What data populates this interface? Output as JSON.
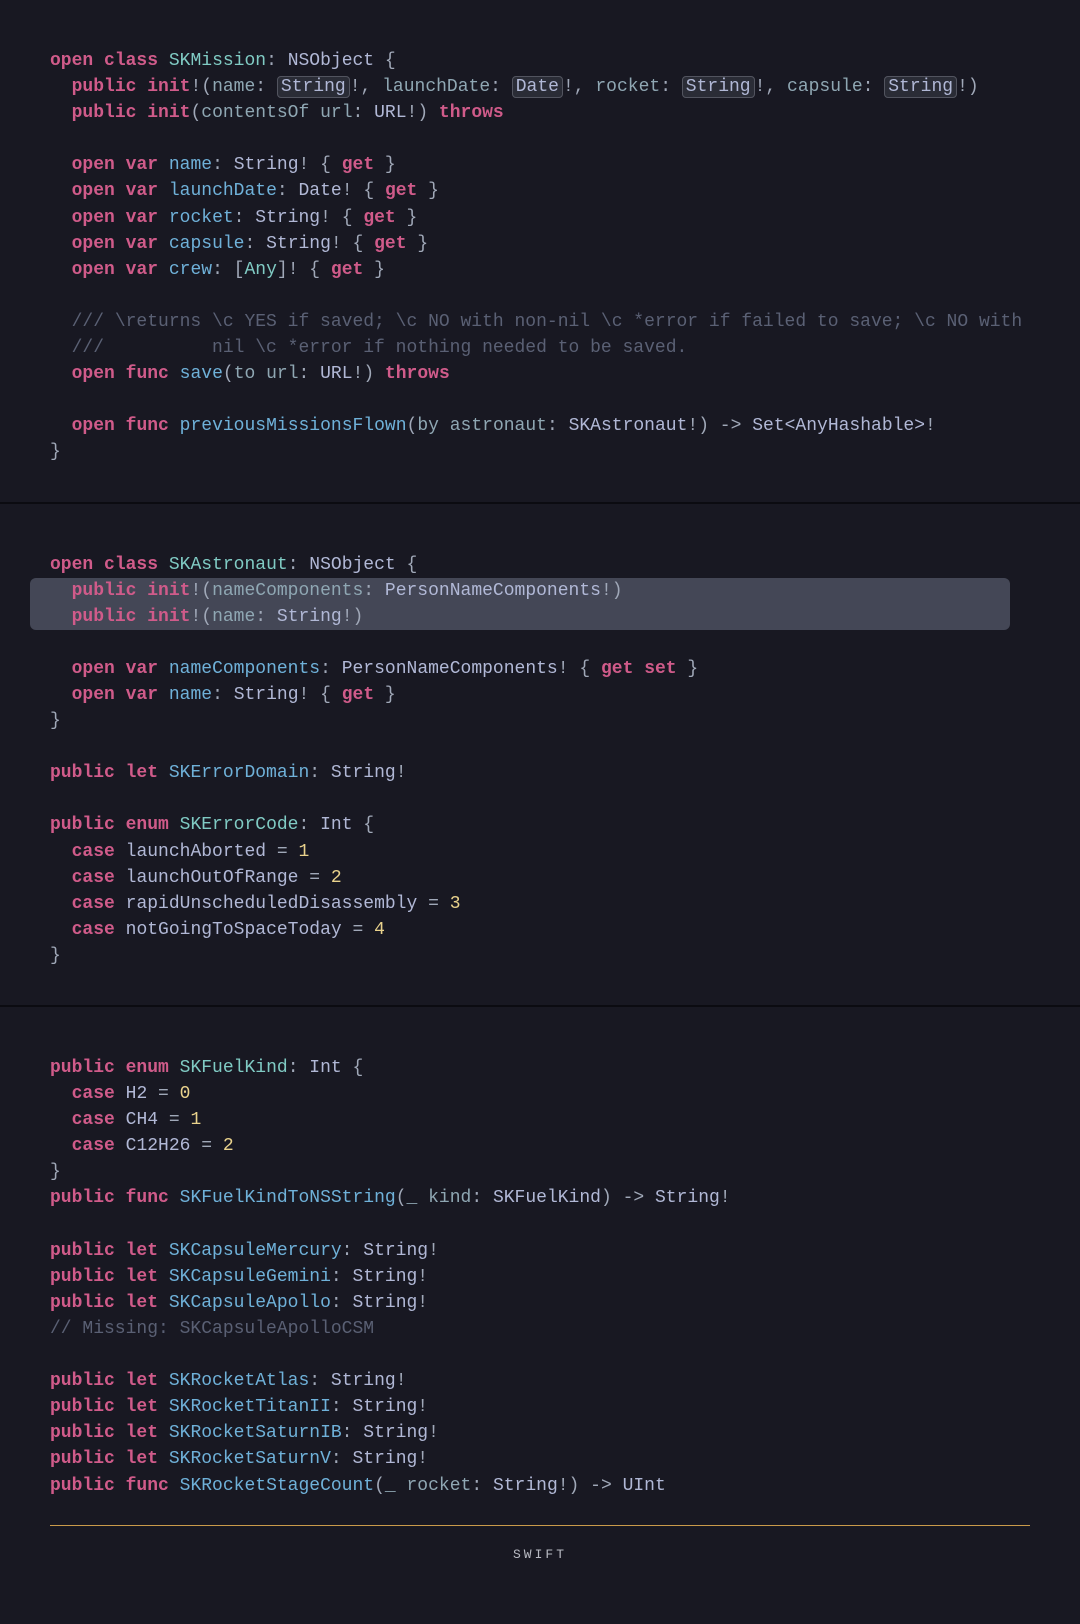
{
  "block1": {
    "l1": {
      "kw1": "open",
      "kw2": "class",
      "type": "SKMission",
      "base": "NSObject",
      "open": " {"
    },
    "l2": {
      "kw1": "public",
      "kw2": "init",
      "p1": "name",
      "t1": "String",
      "p2": "launchDate",
      "t2": "Date",
      "p3": "rocket",
      "t3": "String",
      "p4": "capsule",
      "t4": "String"
    },
    "l3": {
      "kw1": "public",
      "kw2": "init",
      "p": "contentsOf url",
      "t": "URL",
      "kw3": "throws"
    },
    "l5": {
      "kw1": "open",
      "kw2": "var",
      "n": "name",
      "t": "String",
      "kw3": "get"
    },
    "l6": {
      "kw1": "open",
      "kw2": "var",
      "n": "launchDate",
      "t": "Date",
      "kw3": "get"
    },
    "l7": {
      "kw1": "open",
      "kw2": "var",
      "n": "rocket",
      "t": "String",
      "kw3": "get"
    },
    "l8": {
      "kw1": "open",
      "kw2": "var",
      "n": "capsule",
      "t": "String",
      "kw3": "get"
    },
    "l9": {
      "kw1": "open",
      "kw2": "var",
      "n": "crew",
      "t": "Any",
      "kw3": "get"
    },
    "c1": "/// \\returns \\c YES if saved; \\c NO with non-nil \\c *error if failed to save; \\c NO with",
    "c2": "///          nil \\c *error if nothing needed to be saved.",
    "l12": {
      "kw1": "open",
      "kw2": "func",
      "n": "save",
      "p": "to url",
      "t": "URL",
      "kw3": "throws"
    },
    "l14": {
      "kw1": "open",
      "kw2": "func",
      "n": "previousMissionsFlown",
      "p": "by astronaut",
      "t": "SKAstronaut",
      "rt": "Set<AnyHashable>"
    },
    "close": "}"
  },
  "block2": {
    "l1": {
      "kw1": "open",
      "kw2": "class",
      "type": "SKAstronaut",
      "base": "NSObject",
      "open": " {"
    },
    "l2": {
      "kw1": "public",
      "kw2": "init",
      "p": "nameComponents",
      "t": "PersonNameComponents"
    },
    "l3": {
      "kw1": "public",
      "kw2": "init",
      "p": "name",
      "t": "String"
    },
    "l5": {
      "kw1": "open",
      "kw2": "var",
      "n": "nameComponents",
      "t": "PersonNameComponents",
      "kw3": "get",
      "kw4": "set"
    },
    "l6": {
      "kw1": "open",
      "kw2": "var",
      "n": "name",
      "t": "String",
      "kw3": "get"
    },
    "close": "}",
    "l8": {
      "kw1": "public",
      "kw2": "let",
      "n": "SKErrorDomain",
      "t": "String"
    },
    "l10": {
      "kw1": "public",
      "kw2": "enum",
      "n": "SKErrorCode",
      "t": "Int",
      "open": " {"
    },
    "l11": {
      "kw": "case",
      "n": "launchAborted",
      "v": "1"
    },
    "l12": {
      "kw": "case",
      "n": "launchOutOfRange",
      "v": "2"
    },
    "l13": {
      "kw": "case",
      "n": "rapidUnscheduledDisassembly",
      "v": "3"
    },
    "l14": {
      "kw": "case",
      "n": "notGoingToSpaceToday",
      "v": "4"
    },
    "close2": "}"
  },
  "block3": {
    "l1": {
      "kw1": "public",
      "kw2": "enum",
      "n": "SKFuelKind",
      "t": "Int",
      "open": " {"
    },
    "l2": {
      "kw": "case",
      "n": "H2",
      "v": "0"
    },
    "l3": {
      "kw": "case",
      "n": "CH4",
      "v": "1"
    },
    "l4": {
      "kw": "case",
      "n": "C12H26",
      "v": "2"
    },
    "close": "}",
    "l6": {
      "kw1": "public",
      "kw2": "func",
      "n": "SKFuelKindToNSString",
      "p": "_ kind",
      "t": "SKFuelKind",
      "rt": "String"
    },
    "l8": {
      "kw1": "public",
      "kw2": "let",
      "n": "SKCapsuleMercury",
      "t": "String"
    },
    "l9": {
      "kw1": "public",
      "kw2": "let",
      "n": "SKCapsuleGemini",
      "t": "String"
    },
    "l10": {
      "kw1": "public",
      "kw2": "let",
      "n": "SKCapsuleApollo",
      "t": "String"
    },
    "c1": "// Missing: SKCapsuleApolloCSM",
    "l12": {
      "kw1": "public",
      "kw2": "let",
      "n": "SKRocketAtlas",
      "t": "String"
    },
    "l13": {
      "kw1": "public",
      "kw2": "let",
      "n": "SKRocketTitanII",
      "t": "String"
    },
    "l14": {
      "kw1": "public",
      "kw2": "let",
      "n": "SKRocketSaturnIB",
      "t": "String"
    },
    "l15": {
      "kw1": "public",
      "kw2": "let",
      "n": "SKRocketSaturnV",
      "t": "String"
    },
    "l16": {
      "kw1": "public",
      "kw2": "func",
      "n": "SKRocketStageCount",
      "p": "_ rocket",
      "t": "String",
      "rt": "UInt"
    }
  },
  "footer": {
    "label": "SWIFT"
  }
}
